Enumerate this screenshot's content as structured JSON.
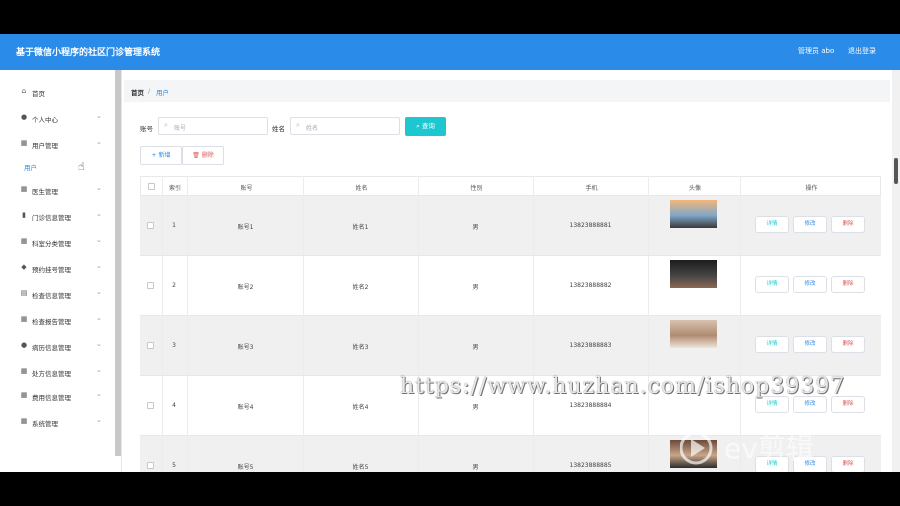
{
  "app": {
    "title": "基于微信小程序的社区门诊管理系统",
    "admin_label": "管理员 abo",
    "logout_label": "退出登录"
  },
  "sidebar": {
    "items": [
      {
        "icon": "home-icon",
        "label": "首页",
        "chev": false
      },
      {
        "icon": "user-icon",
        "label": "个人中心",
        "chev": true
      },
      {
        "icon": "grid-icon",
        "label": "用户管理",
        "chev": true
      },
      {
        "icon": "",
        "label": "用户",
        "chev": false,
        "sub": true
      },
      {
        "icon": "grid-icon",
        "label": "医生管理",
        "chev": true
      },
      {
        "icon": "chart-icon",
        "label": "门诊信息管理",
        "chev": true
      },
      {
        "icon": "grid-icon",
        "label": "科室分类管理",
        "chev": true
      },
      {
        "icon": "pin-icon",
        "label": "预约挂号管理",
        "chev": true
      },
      {
        "icon": "doc-icon",
        "label": "检查信息管理",
        "chev": true
      },
      {
        "icon": "grid-icon",
        "label": "检查报告管理",
        "chev": true
      },
      {
        "icon": "user-icon",
        "label": "病历信息管理",
        "chev": true
      },
      {
        "icon": "grid-icon",
        "label": "处方信息管理",
        "chev": true
      },
      {
        "icon": "grid-icon",
        "label": "费用信息管理",
        "chev": true
      },
      {
        "icon": "grid-icon",
        "label": "系统管理",
        "chev": true
      }
    ]
  },
  "breadcrumb": {
    "home": "首页",
    "separator": "/",
    "current": "用户"
  },
  "filters": {
    "account_label": "账号",
    "account_placeholder": "账号",
    "name_label": "姓名",
    "name_placeholder": "姓名",
    "search_label": "查询"
  },
  "actions": {
    "add_label": "新增",
    "delete_label": "删除"
  },
  "table": {
    "headers": [
      "索引",
      "账号",
      "姓名",
      "性别",
      "手机",
      "头像",
      "操作"
    ],
    "rows": [
      {
        "index": "1",
        "account": "账号1",
        "name": "姓名1",
        "gender": "男",
        "phone": "13823888881"
      },
      {
        "index": "2",
        "account": "账号2",
        "name": "姓名2",
        "gender": "男",
        "phone": "13823888882"
      },
      {
        "index": "3",
        "account": "账号3",
        "name": "姓名3",
        "gender": "男",
        "phone": "13823888883"
      },
      {
        "index": "4",
        "account": "账号4",
        "name": "姓名4",
        "gender": "男",
        "phone": "13823888884"
      },
      {
        "index": "5",
        "account": "账号5",
        "name": "姓名5",
        "gender": "男",
        "phone": "13823888885"
      }
    ],
    "op_detail": "详情",
    "op_edit": "修改",
    "op_delete": "删除"
  },
  "overlay": {
    "watermark": "https://www.huzhan.com/ishop39397",
    "logo_text": "ev剪辑"
  },
  "colors": {
    "primary": "#2a8be8",
    "accent": "#1ec7cf",
    "danger": "#e15555"
  }
}
